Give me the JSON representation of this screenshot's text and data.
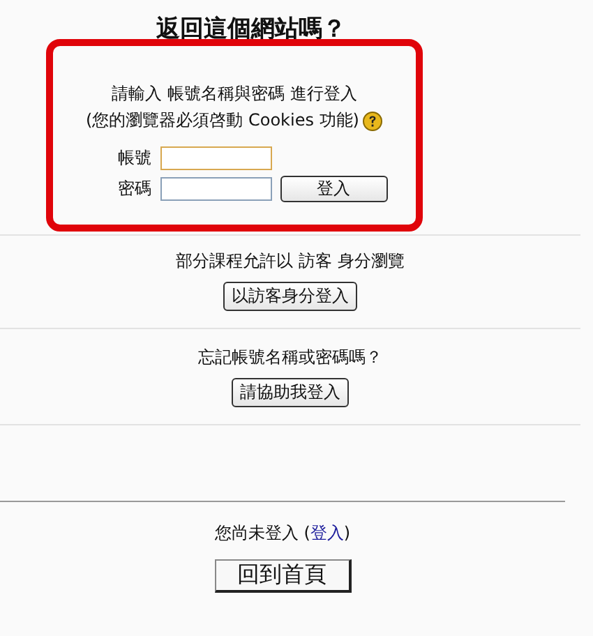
{
  "heading": "返回這個網站嗎？",
  "login": {
    "highlighted": true,
    "intro": "請輸入 帳號名稱與密碼 進行登入",
    "note": "(您的瀏覽器必須啓動 Cookies 功能)",
    "fields": [
      {
        "label": "帳號",
        "focused": true
      },
      {
        "label": "密碼",
        "focused": false
      }
    ],
    "submit": "登入"
  },
  "guest": {
    "text": "部分課程允許以 訪客 身分瀏覽",
    "button": "以訪客身分登入"
  },
  "forgot": {
    "text": "忘記帳號名稱或密碼嗎？",
    "button": "請協助我登入"
  },
  "footer": {
    "status_prefix": "您尚未登入 (",
    "status_link": "登入",
    "status_suffix": ")",
    "home_button": "回到首頁"
  }
}
